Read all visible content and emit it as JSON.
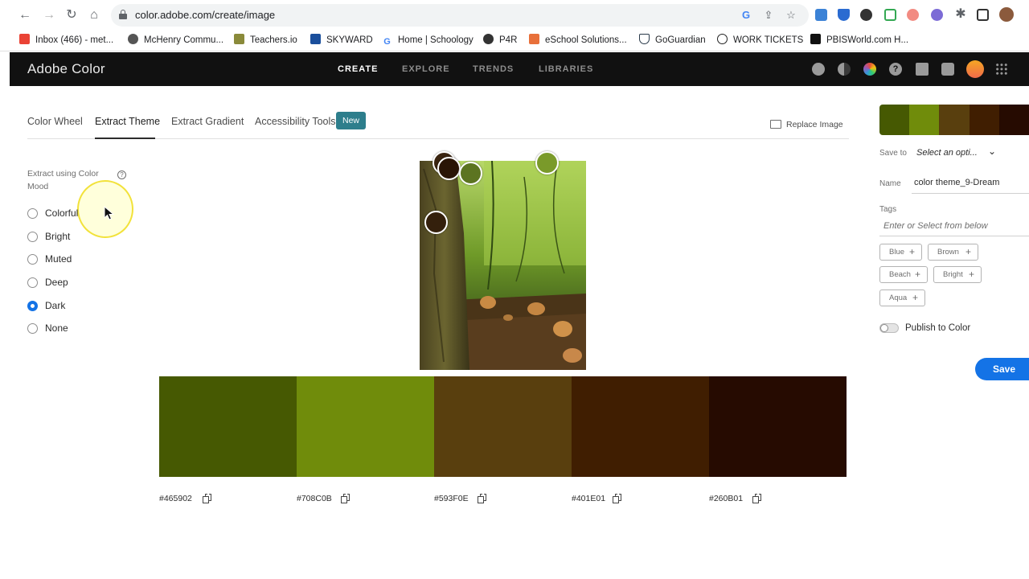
{
  "browser": {
    "url": "color.adobe.com/create/image",
    "bookmarks": [
      {
        "label": "Inbox (466) - met...",
        "color": "#ea4335"
      },
      {
        "label": "McHenry Commu...",
        "color": "#555555"
      },
      {
        "label": "Teachers.io",
        "color": "#8a8a3a"
      },
      {
        "label": "SKYWARD",
        "color": "#1a4f9c"
      },
      {
        "label": "Home | Schoology",
        "color": "#4285f4"
      },
      {
        "label": "P4R",
        "color": "#333333"
      },
      {
        "label": "eSchool Solutions...",
        "color": "#e8703a"
      },
      {
        "label": "GoGuardian",
        "color": "#2a3a4a"
      },
      {
        "label": "WORK TICKETS",
        "color": "#222222"
      },
      {
        "label": "PBISWorld.com H...",
        "color": "#111111"
      }
    ]
  },
  "header": {
    "brand": "Adobe Color",
    "nav": [
      "CREATE",
      "EXPLORE",
      "TRENDS",
      "LIBRARIES"
    ]
  },
  "tabs": {
    "items": [
      "Color Wheel",
      "Extract Theme",
      "Extract Gradient",
      "Accessibility Tools"
    ],
    "badge": "New",
    "replace_image": "Replace Image"
  },
  "mood": {
    "label": "Extract using Color Mood",
    "help": "?",
    "options": [
      "Colorful",
      "Bright",
      "Muted",
      "Deep",
      "Dark",
      "None"
    ],
    "selected": "Dark"
  },
  "theme": {
    "colors": [
      "#465902",
      "#708C0B",
      "#593F0E",
      "#401E01",
      "#260B01"
    ],
    "hex_labels": [
      "#465902",
      "#708C0B",
      "#593F0E",
      "#401E01",
      "#260B01"
    ]
  },
  "picker_colors": [
    "#3a2410",
    "#2a1506",
    "#5c7421",
    "#7a9a2a",
    "#34200c"
  ],
  "right_panel": {
    "save_to_label": "Save to",
    "save_to_value": "Select an opti...",
    "name_label": "Name",
    "name_value": "color theme_9-Dream",
    "tags_label": "Tags",
    "tags_placeholder": "Enter or Select from below",
    "tags": [
      "Blue",
      "Brown",
      "Beach",
      "Bright",
      "Aqua"
    ],
    "publish_label": "Publish to Color",
    "save_button": "Save"
  }
}
